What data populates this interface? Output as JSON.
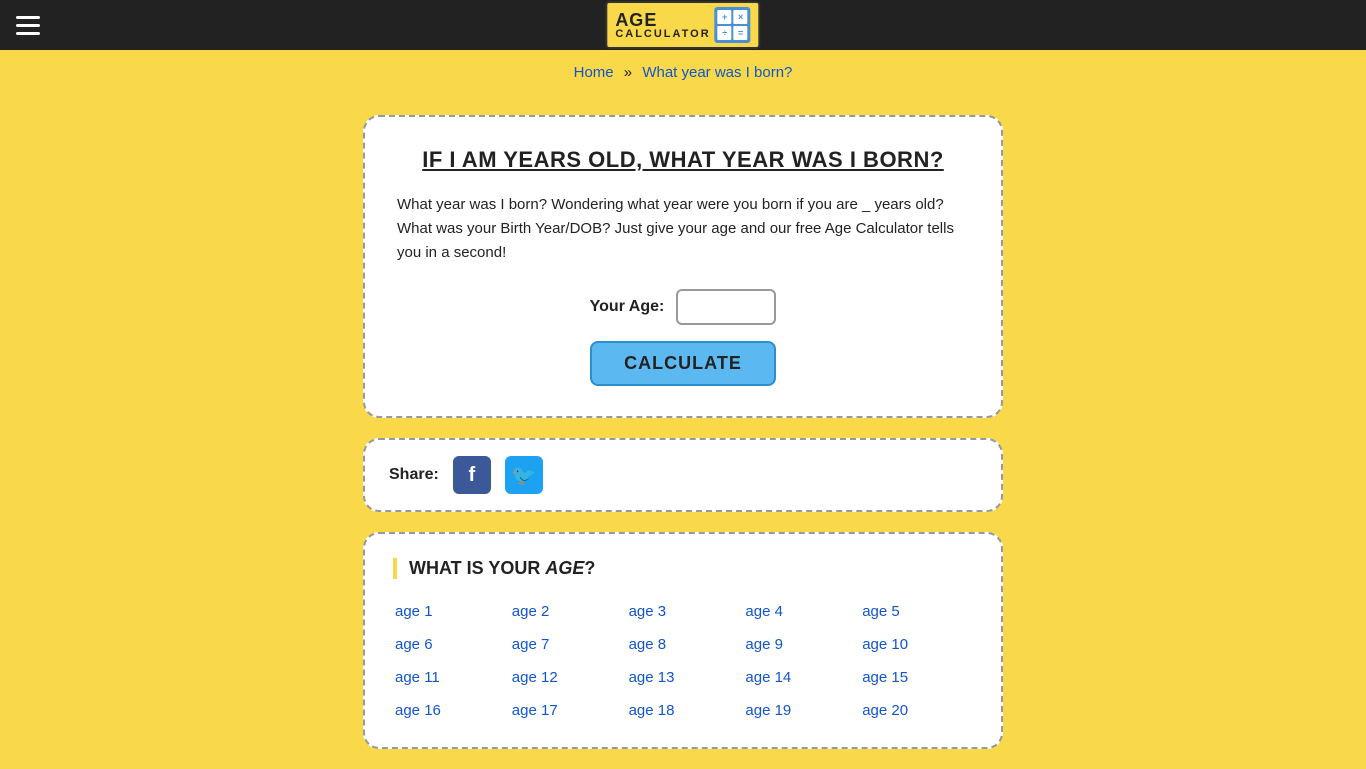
{
  "header": {
    "menu_label": "Menu",
    "logo_text": "AGE",
    "logo_subtext": "CALCULATOR",
    "logo_symbols": [
      "+",
      "×",
      "÷",
      "="
    ]
  },
  "breadcrumb": {
    "home_label": "Home",
    "separator": "»",
    "current_label": "What year was I born?"
  },
  "calculator_card": {
    "title": "IF I AM YEARS OLD, WHAT YEAR WAS I BORN?",
    "description": "What year was I born? Wondering what year were you born if you are _ years old? What was your Birth Year/DOB? Just give your age and our free Age Calculator tells you in a second!",
    "age_label": "Your Age:",
    "age_input_placeholder": "",
    "calculate_button_label": "CALCULATE"
  },
  "share_section": {
    "label": "Share:"
  },
  "age_links_section": {
    "title": "WHAT IS YOUR AGE?",
    "italic_word": "AGE",
    "ages": [
      "age 1",
      "age 2",
      "age 3",
      "age 4",
      "age 5",
      "age 6",
      "age 7",
      "age 8",
      "age 9",
      "age 10",
      "age 11",
      "age 12",
      "age 13",
      "age 14",
      "age 15",
      "age 16",
      "age 17",
      "age 18",
      "age 19",
      "age 20"
    ]
  }
}
